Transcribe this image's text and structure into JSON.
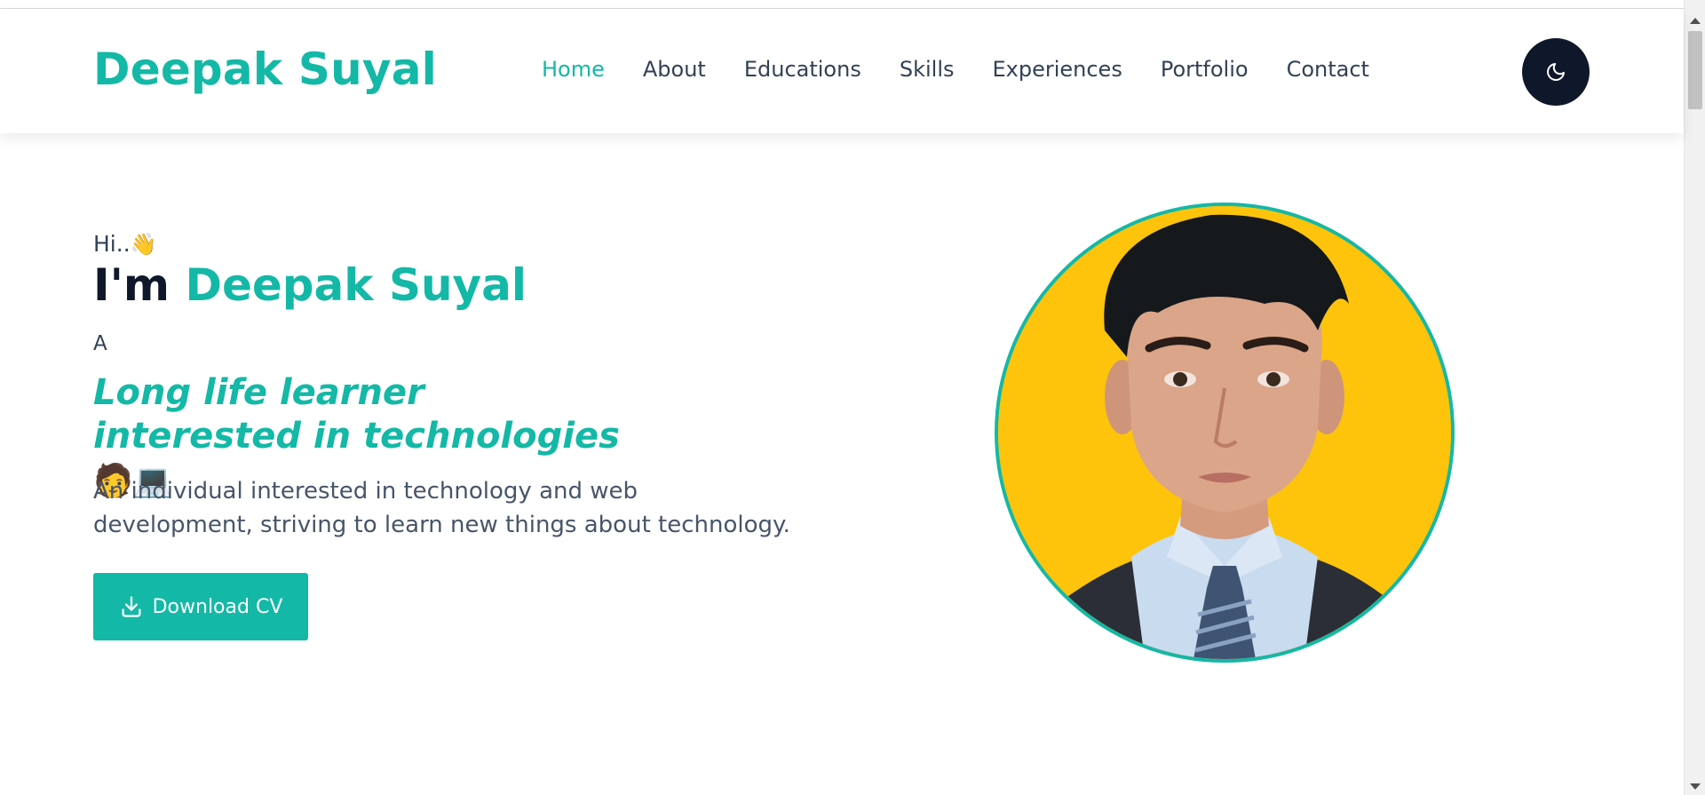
{
  "brand": "Deepak Suyal",
  "nav": {
    "items": [
      {
        "label": "Home",
        "active": true
      },
      {
        "label": "About"
      },
      {
        "label": "Educations"
      },
      {
        "label": "Skills"
      },
      {
        "label": "Experiences"
      },
      {
        "label": "Portfolio"
      },
      {
        "label": "Contact"
      }
    ]
  },
  "theme_toggle": {
    "icon": "moon-icon"
  },
  "hero": {
    "greeting": "Hi..",
    "greeting_emoji": "👋",
    "im": "I'm",
    "name": "Deepak Suyal",
    "article": "A",
    "tagline": "Long life learner interested in technologies",
    "tagline_emoji": "🧑💻",
    "description": "An individual interested in technology and web development, striving to learn new things about technology.",
    "cta_label": "Download CV",
    "cta_icon": "download-icon"
  },
  "colors": {
    "accent": "#14b8a6",
    "dark": "#0f172a",
    "text": "#334155",
    "photo_bg": "#fdc40b"
  }
}
